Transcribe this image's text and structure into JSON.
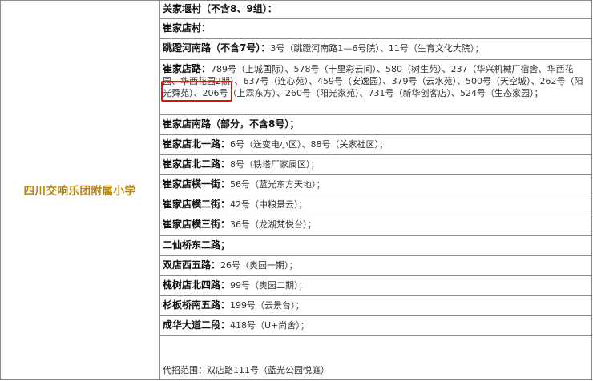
{
  "school": "四川交响乐团附属小学",
  "rows": [
    {
      "road": "关家堰村（不含8、9组）：",
      "addr": ""
    },
    {
      "road": "崔家店村：",
      "addr": ""
    },
    {
      "road": "跳蹬河南路（不含7号）：",
      "addr": "3号（跳蹬河南路1—6号院）、11号（生育文化大院）；"
    },
    {
      "road": "崔家店路：",
      "addr": "789号（上城国际）、578号（十里彩云间）、580（树生苑）、237（华兴机械厂宿舍、华西花园、华西花园2期）、637号（连心苑）、459号（安逸园）、379号（云水苑）、500号（天空城）、262号（阳光舜苑）、206号（上霖东方）、260号（阳光家苑）、731号（新华创客店）、524号（生态家园）；"
    },
    {
      "road": "崔家店南路（部分，不含8号）；",
      "addr": ""
    },
    {
      "road": "崔家店北一路：",
      "addr": "6号（送变电小区）、88号（关家社区）；"
    },
    {
      "road": "崔家店北二路：",
      "addr": "8号（铁塔厂家属区）；"
    },
    {
      "road": "崔家店横一街：",
      "addr": "56号（蓝光东方天地）；"
    },
    {
      "road": "崔家店横二街：",
      "addr": "42号（中粮景云）；"
    },
    {
      "road": "崔家店横三街：",
      "addr": "36号（龙湖梵悦台）；"
    },
    {
      "road": "二仙桥东二路；",
      "addr": ""
    },
    {
      "road": "双店西五路：",
      "addr": "26号（奥园一期）；"
    },
    {
      "road": "槐树店北四路：",
      "addr": "99号（奥园二期）；"
    },
    {
      "road": "杉板桥南五路：",
      "addr": "199号（云景台）；"
    },
    {
      "road": "成华大道二段：",
      "addr": "418号（U+尚舍）；"
    }
  ],
  "footer": "代招范围：双店路111号（蓝光公园悦庭）",
  "colors": {
    "school_text": "#b8860b",
    "highlight_border": "#e01010",
    "grid": "#8c8c8c"
  }
}
